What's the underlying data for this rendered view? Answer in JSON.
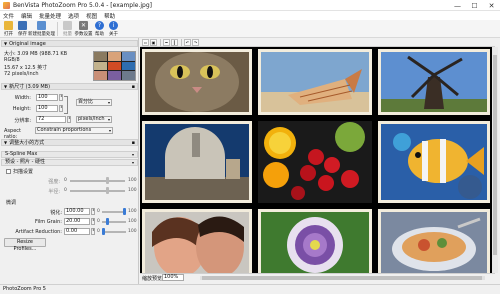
{
  "window": {
    "title": "BenVista PhotoZoom Pro 5.0.4 - [example.jpg]",
    "controls": [
      "—",
      "☐",
      "✕"
    ]
  },
  "menu": [
    "文件",
    "编辑",
    "批量处理",
    "选项",
    "视图",
    "帮助"
  ],
  "toolbar": {
    "open": "打开",
    "save": "保存",
    "new_batch": "新建批量处理",
    "batch": "批量",
    "preset_settings": "参数设置",
    "help": "帮助",
    "about": "关于"
  },
  "original_image": {
    "header": "Original image",
    "info": [
      "大小: 3.09 MB (988.71 KB",
      "RGB/8",
      "15.67 x 12.5 英寸",
      "72 pixels/inch"
    ]
  },
  "new_size": {
    "header": "新尺寸 (3.09 MB)",
    "width_label": "Width:",
    "width_value": "100",
    "height_label": "Height:",
    "height_value": "100",
    "resolution_label": "分辨率:",
    "resolution_value": "72",
    "unit_percent": "百分比",
    "unit_resolution": "pixels/inch",
    "aspect_label": "Aspect ratio:",
    "aspect_value": "Constrain proportions"
  },
  "resize_method": {
    "header": "调整大小的方式",
    "method": "S-Spline Max",
    "preset": "预设 - 照片 - 硬性",
    "advanced_label": "扫描设置",
    "sharpness_label": "强度:",
    "radius_label": "半径:",
    "sharpness_min": "0",
    "sharpness_max": "100",
    "radius_min": "0",
    "radius_max": "100",
    "fine_tuning_header": "微调",
    "details_label": "锐化:",
    "details_value": "100.00",
    "grain_label": "Film Grain:",
    "grain_value": "20.00",
    "artifact_label": "Artifact Reduction:",
    "artifact_value": "0.00",
    "slider_min": "0",
    "slider_max": "100",
    "details_level": 1.0,
    "grain_level": 0.2,
    "artifact_level": 0.0,
    "profiles_button": "Resize Profiles..."
  },
  "view": {
    "zoom_label": "缩放预览:",
    "zoom_value": "100%"
  },
  "status": {
    "text": "PhotoZoom Pro 5"
  },
  "colors": {
    "accent": "#3a7bd5",
    "viewer_bg": "#000000"
  }
}
